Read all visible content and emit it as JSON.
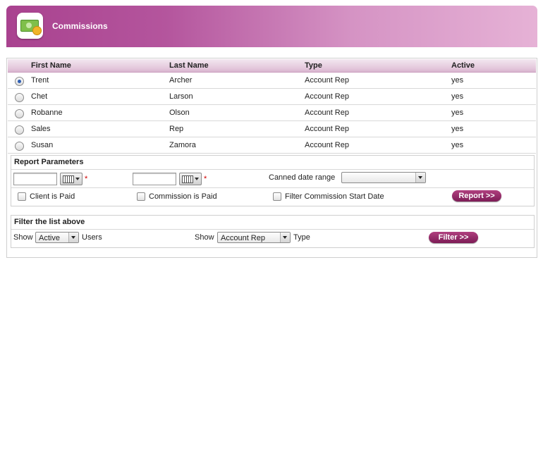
{
  "header": {
    "title": "Commissions",
    "icon": "money-icon"
  },
  "table": {
    "columns": [
      "First Name",
      "Last Name",
      "Type",
      "Active"
    ],
    "rows": [
      {
        "first": "Trent",
        "last": "Archer",
        "type": "Account Rep",
        "active": "yes",
        "selected": true
      },
      {
        "first": "Chet",
        "last": "Larson",
        "type": "Account Rep",
        "active": "yes",
        "selected": false
      },
      {
        "first": "Robanne",
        "last": "Olson",
        "type": "Account Rep",
        "active": "yes",
        "selected": false
      },
      {
        "first": "Sales",
        "last": "Rep",
        "type": "Account Rep",
        "active": "yes",
        "selected": false
      },
      {
        "first": "Susan",
        "last": "Zamora",
        "type": "Account Rep",
        "active": "yes",
        "selected": false
      }
    ]
  },
  "report": {
    "title": "Report Parameters",
    "start_date": "",
    "end_date": "",
    "required_mark": "*",
    "canned_label": "Canned date range",
    "canned_value": "",
    "client_paid_label": "Client is Paid",
    "commission_paid_label": "Commission is Paid",
    "filter_start_label": "Filter Commission Start Date",
    "button": "Report >>"
  },
  "filter": {
    "title": "Filter the list above",
    "show_label": "Show",
    "status_value": "Active",
    "users_label": "Users",
    "show_label2": "Show",
    "type_value": "Account Rep",
    "type_label": "Type",
    "button": "Filter >>"
  },
  "colors": {
    "accent": "#a9428f",
    "button": "#8e2766",
    "required": "#d00000"
  }
}
